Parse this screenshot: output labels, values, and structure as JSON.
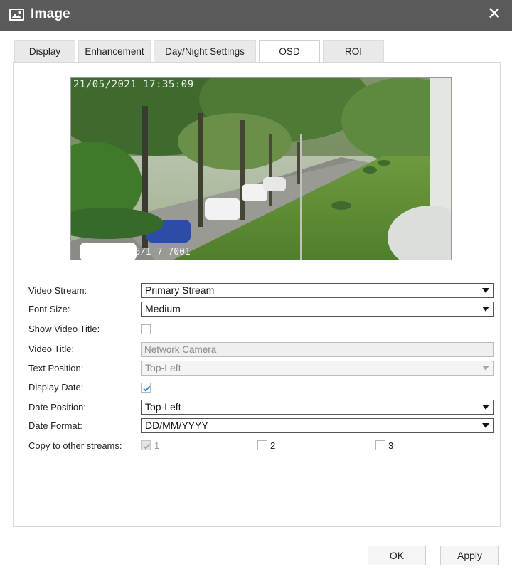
{
  "dialog": {
    "title": "Image",
    "close_glyph": "✕",
    "title_icon": "image-icon"
  },
  "tabs": [
    {
      "label": "Display",
      "active": false
    },
    {
      "label": "Enhancement",
      "active": false
    },
    {
      "label": "Day/Night Settings",
      "active": false
    },
    {
      "label": "OSD",
      "active": true
    },
    {
      "label": "ROI",
      "active": false
    }
  ],
  "preview": {
    "osd_time": "21/05/2021 17:35:09",
    "osd_title": "P246/I-7 7001"
  },
  "form": {
    "video_stream": {
      "label": "Video Stream:",
      "value": "Primary Stream"
    },
    "font_size": {
      "label": "Font Size:",
      "value": "Medium"
    },
    "show_video_title": {
      "label": "Show Video Title:",
      "checked": false
    },
    "video_title": {
      "label": "Video Title:",
      "placeholder": "Network Camera",
      "value": ""
    },
    "text_position": {
      "label": "Text Position:",
      "value": "Top-Left",
      "disabled": true
    },
    "display_date": {
      "label": "Display Date:",
      "checked": true
    },
    "date_position": {
      "label": "Date Position:",
      "value": "Top-Left"
    },
    "date_format": {
      "label": "Date Format:",
      "value": "DD/MM/YYYY"
    },
    "copy_streams": {
      "label": "Copy to other streams:",
      "options": [
        {
          "label": "1",
          "checked": true,
          "disabled": true
        },
        {
          "label": "2",
          "checked": false,
          "disabled": false
        },
        {
          "label": "3",
          "checked": false,
          "disabled": false
        }
      ]
    }
  },
  "buttons": {
    "ok": "OK",
    "apply": "Apply"
  },
  "colors": {
    "titlebar": "#5a5a5a",
    "check_accent": "#2a7fd4"
  }
}
